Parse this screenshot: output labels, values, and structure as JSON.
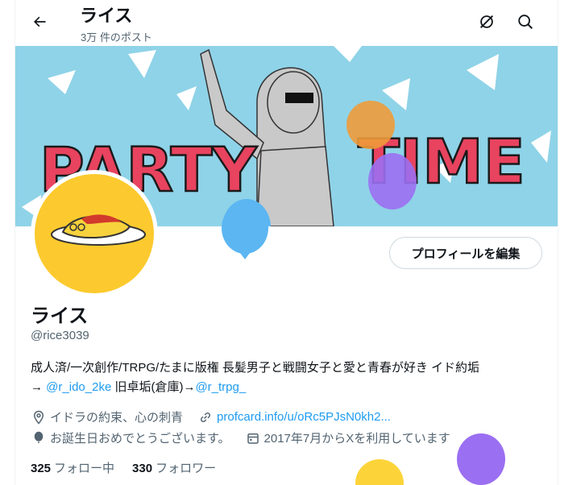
{
  "header": {
    "title": "ライス",
    "post_count": "3万 件のポスト"
  },
  "banner": {
    "word1": "PARTY",
    "word2": "TIME",
    "background_color": "#8fd3e8",
    "letter_color": "#e8435f"
  },
  "profile": {
    "name": "ライス",
    "handle": "@rice3039",
    "edit_label": "プロフィールを編集",
    "avatar_bg": "#fcca2e",
    "bio_line1": "成人済/一次創作/TRPG/たまに版権  長髪男子と戦闘女子と愛と青春が好き イド約垢",
    "bio_arrow1": "→ ",
    "bio_link1": "@r_ido_2ke",
    "bio_mid": "  旧卓垢(倉庫)→",
    "bio_link2": "@r_trpg_",
    "location": "イドラの約束、心の刺青",
    "website": "profcard.info/u/oRc5PJsN0kh2...",
    "birthday": "お誕生日おめでとうございます。",
    "joined": "2017年7月からXを利用しています"
  },
  "stats": {
    "following_count": "325",
    "following_label": "フォロー中",
    "followers_count": "330",
    "followers_label": "フォロワー"
  },
  "icons": [
    "back-arrow-icon",
    "translate-off-icon",
    "search-icon",
    "location-pin-icon",
    "link-icon",
    "balloon-icon",
    "calendar-icon"
  ],
  "balloon_colors": [
    "#5bb6f2",
    "#9b6ff2",
    "#fcd43a",
    "#ee9b3a"
  ]
}
